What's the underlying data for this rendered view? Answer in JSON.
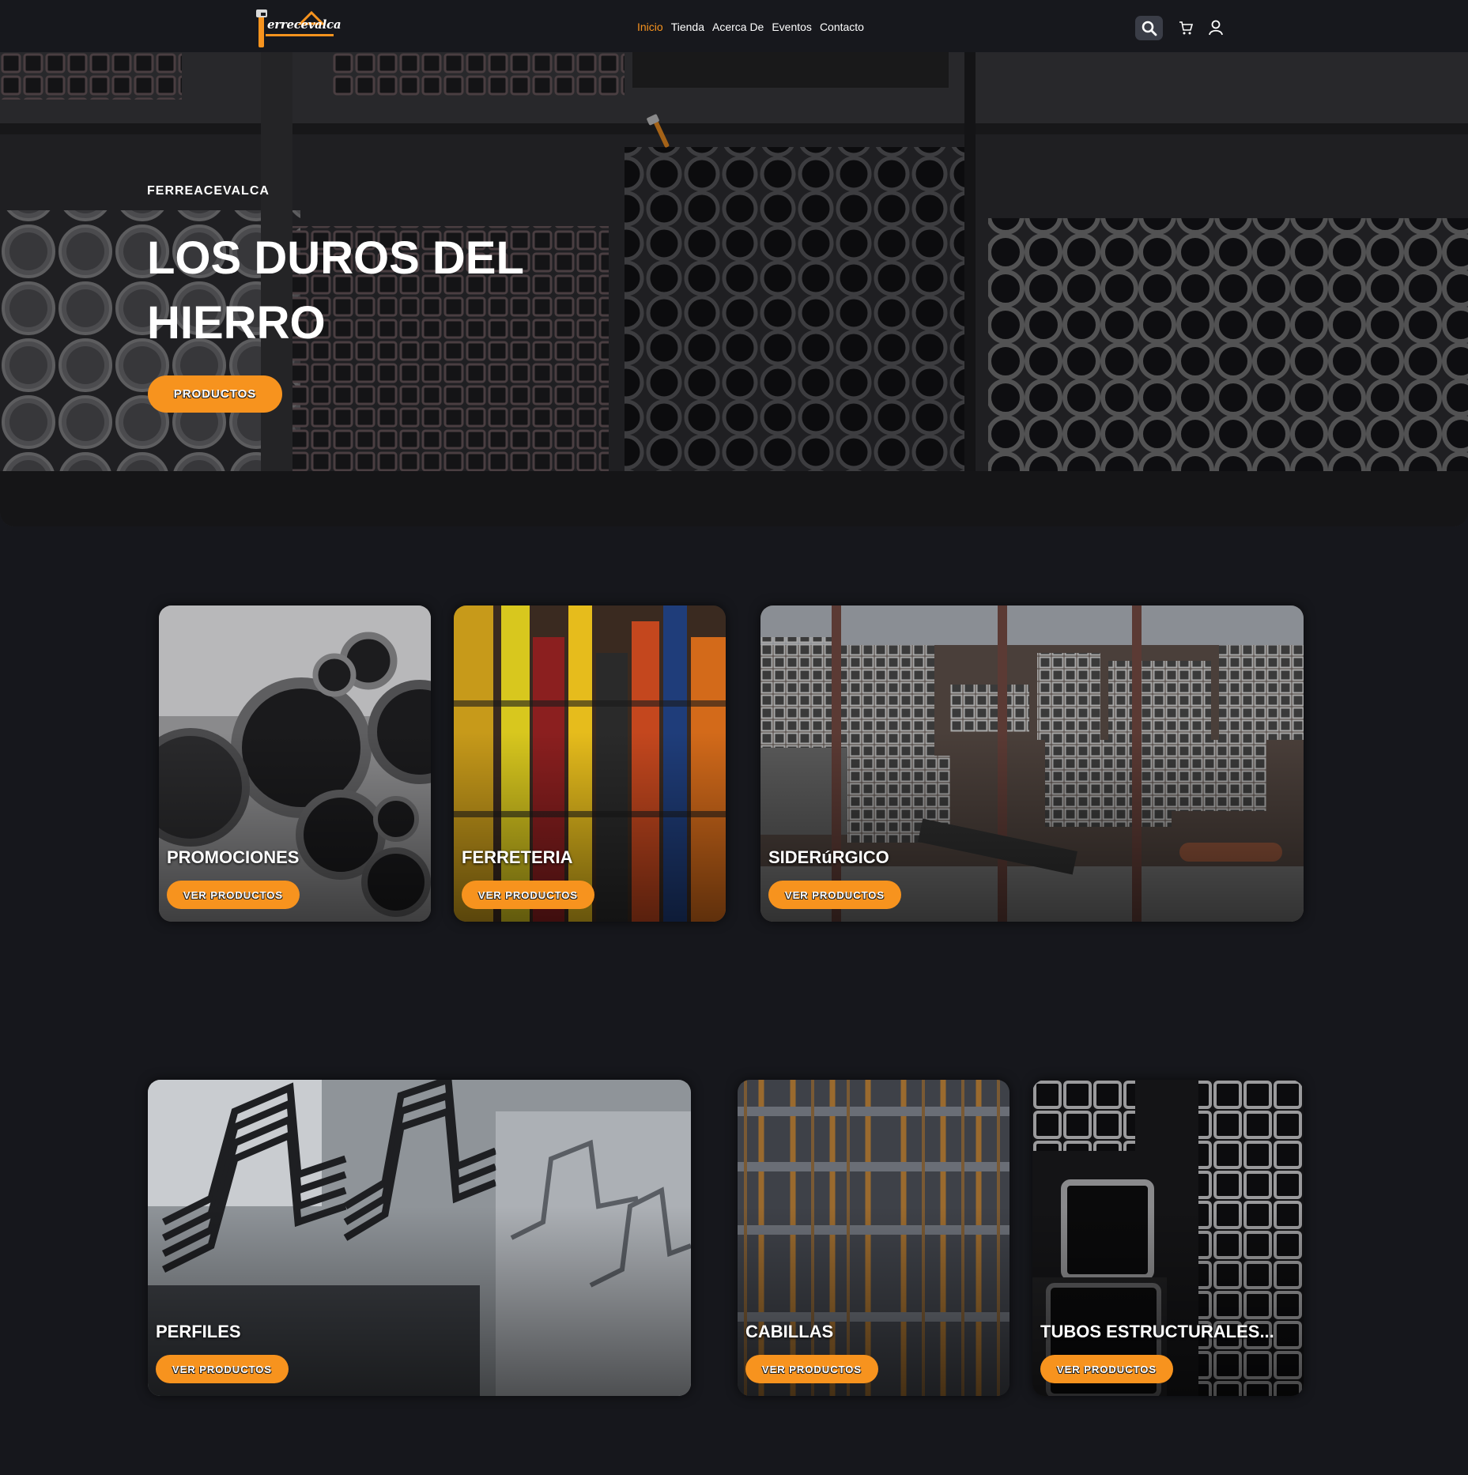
{
  "brand": {
    "logo_text": "errecevalca"
  },
  "nav": {
    "items": [
      "Inicio",
      "Tienda",
      "Acerca De",
      "Eventos",
      "Contacto"
    ],
    "active": "Inicio"
  },
  "header_icons": [
    "search-icon",
    "cart-icon",
    "user-icon"
  ],
  "hero": {
    "kicker": "FERREACEVALCA",
    "title_line1": "LOS DUROS DEL",
    "title_line2": "HIERRO",
    "button": "PRODUCTOS"
  },
  "categories": [
    {
      "title": "PROMOCIONES",
      "button": "VER PRODUCTOS"
    },
    {
      "title": "FERRETERIA",
      "button": "VER PRODUCTOS"
    },
    {
      "title": "SIDERúRGICO",
      "button": "VER PRODUCTOS"
    },
    {
      "title": "PERFILES",
      "button": "VER PRODUCTOS"
    },
    {
      "title": "CABILLAS",
      "button": "VER PRODUCTOS"
    },
    {
      "title": "TUBOS ESTRUCTURALES...",
      "button": "VER PRODUCTOS"
    }
  ],
  "colors": {
    "accent": "#f7931e",
    "background": "#16171c",
    "header": "#17181d",
    "search_bg": "#3a3d47"
  }
}
